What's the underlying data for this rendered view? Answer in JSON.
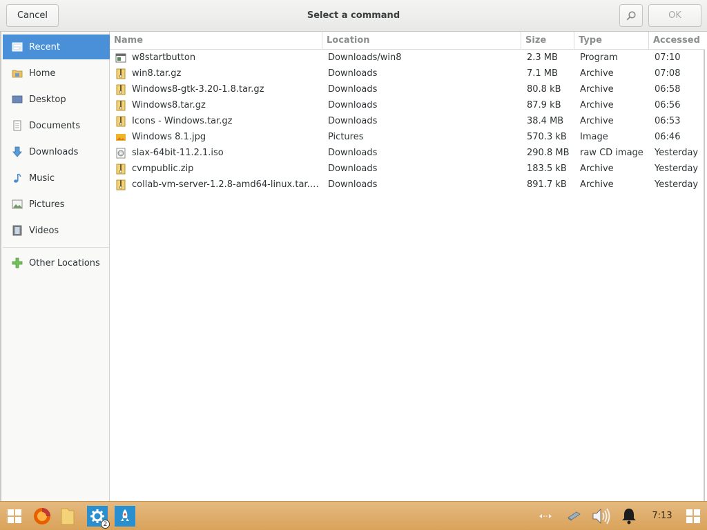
{
  "header": {
    "title": "Select a command",
    "cancel_label": "Cancel",
    "ok_label": "OK",
    "search_icon": "search-icon"
  },
  "sidebar": {
    "items": [
      {
        "label": "Recent",
        "icon": "recent-icon",
        "selected": true
      },
      {
        "label": "Home",
        "icon": "home-folder-icon"
      },
      {
        "label": "Desktop",
        "icon": "desktop-icon"
      },
      {
        "label": "Documents",
        "icon": "documents-icon"
      },
      {
        "label": "Downloads",
        "icon": "downloads-icon"
      },
      {
        "label": "Music",
        "icon": "music-icon"
      },
      {
        "label": "Pictures",
        "icon": "pictures-icon"
      },
      {
        "label": "Videos",
        "icon": "videos-icon"
      }
    ],
    "other": {
      "label": "Other Locations",
      "icon": "plus-icon"
    }
  },
  "table": {
    "columns": [
      "Name",
      "Location",
      "Size",
      "Type",
      "Accessed"
    ],
    "rows": [
      {
        "name": "w8startbutton",
        "location": "Downloads/win8",
        "size": "2.3 MB",
        "type": "Program",
        "accessed": "07:10",
        "icon": "program-file-icon"
      },
      {
        "name": "win8.tar.gz",
        "location": "Downloads",
        "size": "7.1 MB",
        "type": "Archive",
        "accessed": "07:08",
        "icon": "archive-file-icon"
      },
      {
        "name": "Windows8-gtk-3.20-1.8.tar.gz",
        "location": "Downloads",
        "size": "80.8 kB",
        "type": "Archive",
        "accessed": "06:58",
        "icon": "archive-file-icon"
      },
      {
        "name": "Windows8.tar.gz",
        "location": "Downloads",
        "size": "87.9 kB",
        "type": "Archive",
        "accessed": "06:56",
        "icon": "archive-file-icon"
      },
      {
        "name": "Icons - Windows.tar.gz",
        "location": "Downloads",
        "size": "38.4 MB",
        "type": "Archive",
        "accessed": "06:53",
        "icon": "archive-file-icon"
      },
      {
        "name": "Windows 8.1.jpg",
        "location": "Pictures",
        "size": "570.3 kB",
        "type": "Image",
        "accessed": "06:46",
        "icon": "image-file-icon"
      },
      {
        "name": "slax-64bit-11.2.1.iso",
        "location": "Downloads",
        "size": "290.8 MB",
        "type": "raw CD image",
        "accessed": "Yesterday",
        "icon": "disc-image-file-icon"
      },
      {
        "name": "cvmpublic.zip",
        "location": "Downloads",
        "size": "183.5 kB",
        "type": "Archive",
        "accessed": "Yesterday",
        "icon": "archive-file-icon"
      },
      {
        "name": "collab-vm-server-1.2.8-amd64-linux.tar.…",
        "location": "Downloads",
        "size": "891.7 kB",
        "type": "Archive",
        "accessed": "Yesterday",
        "icon": "archive-file-icon"
      }
    ]
  },
  "taskbar": {
    "clock": "7:13",
    "settings_badge": "2",
    "colors": {
      "bar": "#dcaa65",
      "accent": "#4a90d9"
    }
  }
}
